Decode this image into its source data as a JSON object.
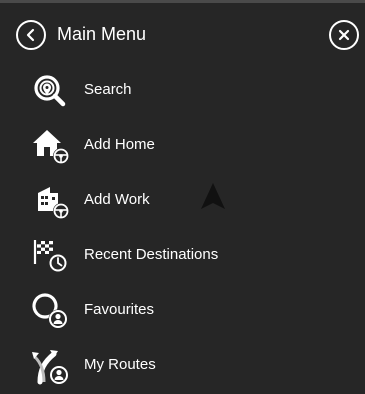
{
  "header": {
    "title": "Main Menu",
    "back_icon": "chevron-left-icon",
    "close_icon": "close-icon"
  },
  "menu": {
    "items": [
      {
        "label": "Search",
        "icon": "search-icon"
      },
      {
        "label": "Add Home",
        "icon": "home-icon"
      },
      {
        "label": "Add Work",
        "icon": "work-building-icon"
      },
      {
        "label": "Recent Destinations",
        "icon": "recent-destinations-icon"
      },
      {
        "label": "Favourites",
        "icon": "favourites-icon"
      },
      {
        "label": "My Routes",
        "icon": "my-routes-icon"
      }
    ]
  },
  "map": {
    "position_marker_icon": "navigation-arrow-icon"
  },
  "colors": {
    "background": "#262626",
    "text": "#ffffff",
    "icon": "#ffffff"
  }
}
